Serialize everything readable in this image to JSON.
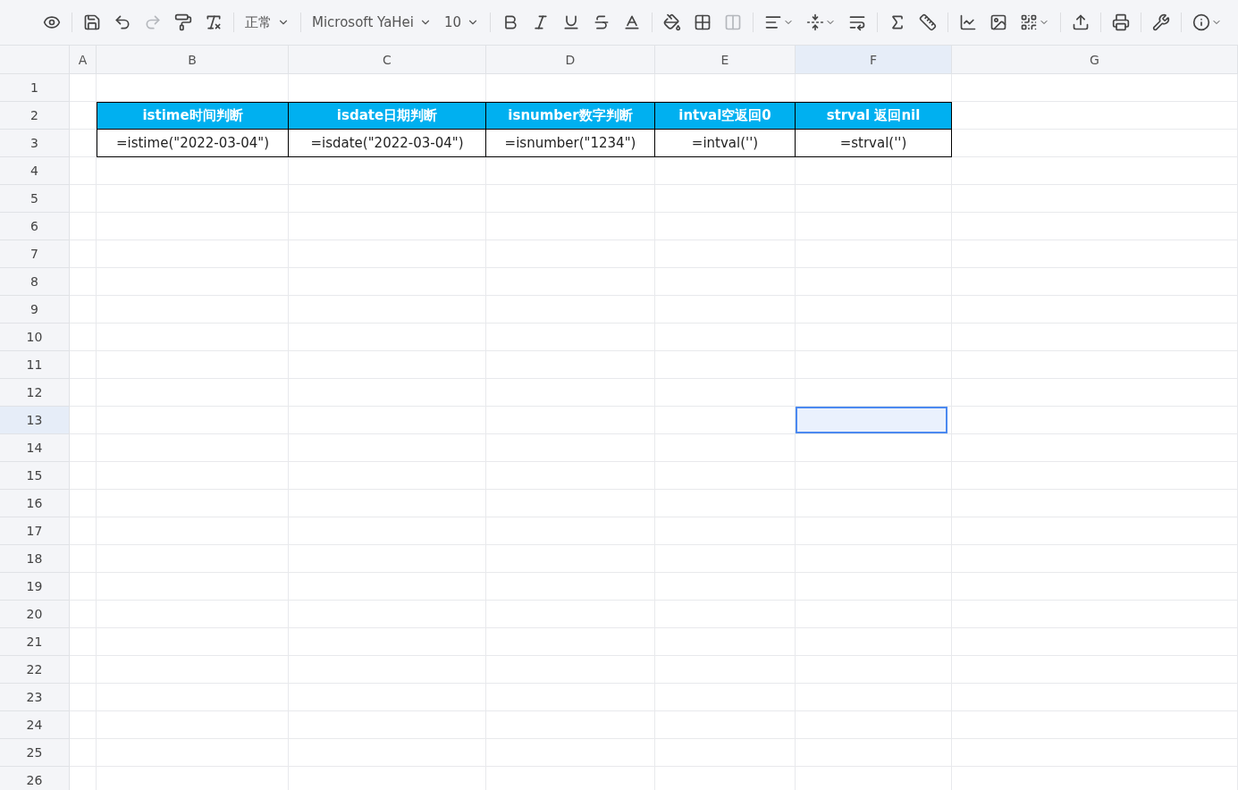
{
  "toolbar": [
    {
      "kind": "preview",
      "disabled": false
    },
    {
      "kind": "separator"
    },
    {
      "kind": "save",
      "disabled": false
    },
    {
      "kind": "undo",
      "disabled": false
    },
    {
      "kind": "redo",
      "disabled": true
    },
    {
      "kind": "format-painter",
      "disabled": false
    },
    {
      "kind": "clear-format",
      "disabled": false
    },
    {
      "kind": "separator"
    },
    {
      "kind": "select",
      "label": "正常"
    },
    {
      "kind": "separator"
    },
    {
      "kind": "select",
      "label": "Microsoft YaHei"
    },
    {
      "kind": "select",
      "label": "10"
    },
    {
      "kind": "separator"
    },
    {
      "kind": "bold",
      "disabled": false
    },
    {
      "kind": "italic",
      "disabled": false
    },
    {
      "kind": "underline",
      "disabled": false
    },
    {
      "kind": "strike",
      "disabled": false
    },
    {
      "kind": "font-color",
      "disabled": false
    },
    {
      "kind": "separator"
    },
    {
      "kind": "fill",
      "disabled": false
    },
    {
      "kind": "borders",
      "disabled": false
    },
    {
      "kind": "merge",
      "disabled": true
    },
    {
      "kind": "separator"
    },
    {
      "kind": "align",
      "disabled": false,
      "menu": true
    },
    {
      "kind": "valign",
      "disabled": false,
      "menu": true
    },
    {
      "kind": "wrap",
      "disabled": false
    },
    {
      "kind": "separator"
    },
    {
      "kind": "function",
      "disabled": false
    },
    {
      "kind": "rotate",
      "disabled": false
    },
    {
      "kind": "separator"
    },
    {
      "kind": "chart",
      "disabled": false
    },
    {
      "kind": "image",
      "disabled": false
    },
    {
      "kind": "qrcode",
      "disabled": false,
      "menu": true
    },
    {
      "kind": "separator"
    },
    {
      "kind": "upload",
      "disabled": false
    },
    {
      "kind": "separator"
    },
    {
      "kind": "print",
      "disabled": false
    },
    {
      "kind": "separator"
    },
    {
      "kind": "tools",
      "disabled": false
    },
    {
      "kind": "separator"
    },
    {
      "kind": "info",
      "disabled": false,
      "menu": true
    }
  ],
  "columns": [
    {
      "label": "A",
      "selected": false
    },
    {
      "label": "B",
      "selected": false
    },
    {
      "label": "C",
      "selected": false
    },
    {
      "label": "D",
      "selected": false
    },
    {
      "label": "E",
      "selected": false
    },
    {
      "label": "F",
      "selected": true
    },
    {
      "label": "G",
      "selected": false
    }
  ],
  "rows": [
    {
      "label": "1",
      "selected": false
    },
    {
      "label": "2",
      "selected": false
    },
    {
      "label": "3",
      "selected": false
    },
    {
      "label": "4",
      "selected": false
    },
    {
      "label": "5",
      "selected": false
    },
    {
      "label": "6",
      "selected": false
    },
    {
      "label": "7",
      "selected": false
    },
    {
      "label": "8",
      "selected": false
    },
    {
      "label": "9",
      "selected": false
    },
    {
      "label": "10",
      "selected": false
    },
    {
      "label": "11",
      "selected": false
    },
    {
      "label": "12",
      "selected": false
    },
    {
      "label": "13",
      "selected": true
    },
    {
      "label": "14",
      "selected": false
    },
    {
      "label": "15",
      "selected": false
    },
    {
      "label": "16",
      "selected": false
    },
    {
      "label": "17",
      "selected": false
    },
    {
      "label": "18",
      "selected": false
    },
    {
      "label": "19",
      "selected": false
    },
    {
      "label": "20",
      "selected": false
    },
    {
      "label": "21",
      "selected": false
    },
    {
      "label": "22",
      "selected": false
    },
    {
      "label": "23",
      "selected": false
    },
    {
      "label": "24",
      "selected": false
    },
    {
      "label": "25",
      "selected": false
    },
    {
      "label": "26",
      "selected": false
    }
  ],
  "table": {
    "headers": [
      "istime时间判断",
      "isdate日期判断",
      "isnumber数字判断",
      "intval空返回0",
      "strval 返回nil"
    ],
    "formulas": [
      "=istime(\"2022-03-04\")",
      "=isdate(\"2022-03-04\")",
      "=isnumber(\"1234\")",
      "=intval('')",
      "=strval('')"
    ]
  }
}
